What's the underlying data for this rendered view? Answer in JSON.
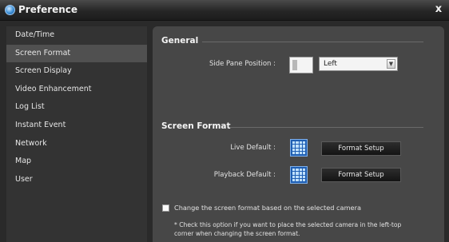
{
  "window": {
    "title": "Preference",
    "close_glyph": "x"
  },
  "sidebar": {
    "items": [
      {
        "label": "Date/Time",
        "selected": false
      },
      {
        "label": "Screen Format",
        "selected": true
      },
      {
        "label": "Screen Display",
        "selected": false
      },
      {
        "label": "Video Enhancement",
        "selected": false
      },
      {
        "label": "Log List",
        "selected": false
      },
      {
        "label": "Instant Event",
        "selected": false
      },
      {
        "label": "Network",
        "selected": false
      },
      {
        "label": "Map",
        "selected": false
      },
      {
        "label": "User",
        "selected": false
      }
    ]
  },
  "general": {
    "heading": "General",
    "side_pane_label": "Side Pane Position :",
    "side_pane_value": "Left"
  },
  "screen_format": {
    "heading": "Screen Format",
    "live_label": "Live Default :",
    "live_button": "Format Setup",
    "playback_label": "Playback Default :",
    "playback_button": "Format Setup",
    "checkbox_label": "Change the screen format based on the selected camera",
    "checkbox_checked": false,
    "note_line1": "* Check this option if you want to place the selected camera in the left-top",
    "note_line2": "corner when changing the screen format."
  },
  "colors": {
    "background": "#2a2a2a",
    "panel": "#474747",
    "selected_item": "#505050",
    "grid_icon_blue": "#1f5fb3"
  }
}
